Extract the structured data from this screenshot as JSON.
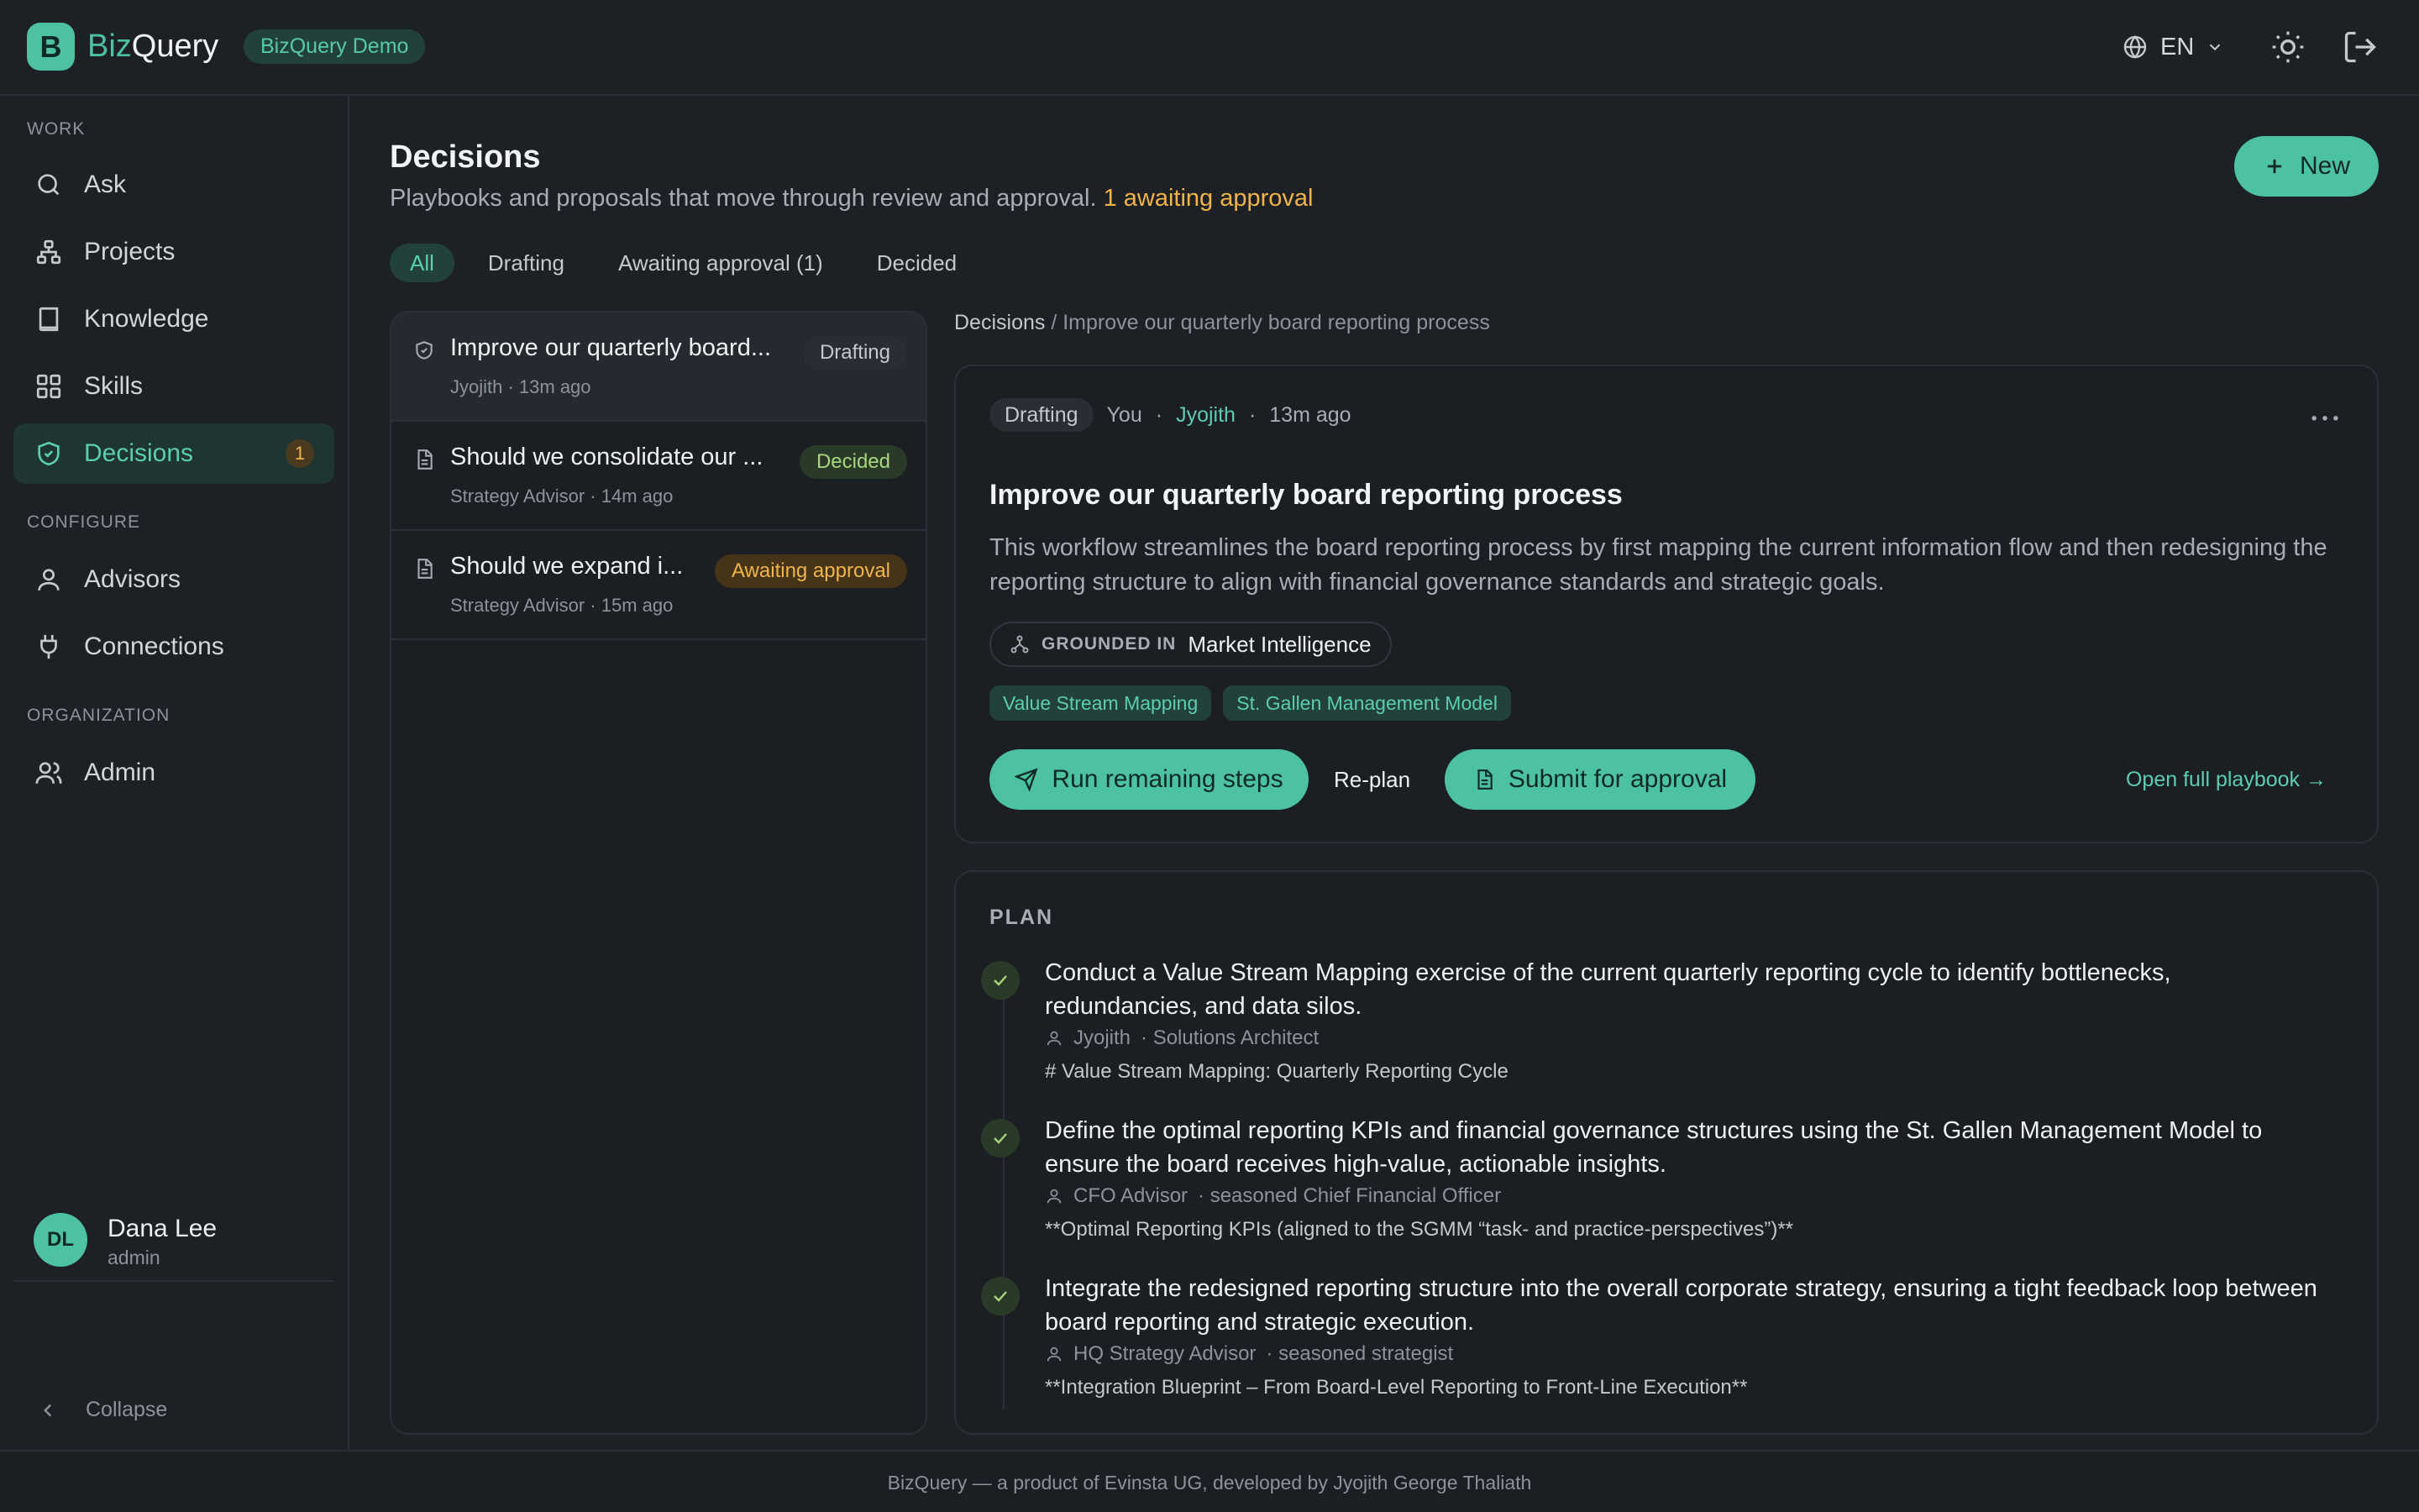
{
  "header": {
    "logo_letter": "B",
    "brand_prefix": "Biz",
    "brand_suffix": "Query",
    "demo_badge": "BizQuery Demo",
    "language": "EN"
  },
  "sidebar": {
    "sections": {
      "work": "WORK",
      "configure": "CONFIGURE",
      "organization": "ORGANIZATION"
    },
    "items": [
      {
        "label": "Ask",
        "icon": "search-icon"
      },
      {
        "label": "Projects",
        "icon": "hierarchy-icon"
      },
      {
        "label": "Knowledge",
        "icon": "book-icon"
      },
      {
        "label": "Skills",
        "icon": "grid-icon"
      },
      {
        "label": "Decisions",
        "icon": "shield-check-icon",
        "active": true,
        "count": "1"
      },
      {
        "label": "Advisors",
        "icon": "user-icon"
      },
      {
        "label": "Connections",
        "icon": "plug-icon"
      },
      {
        "label": "Admin",
        "icon": "users-icon"
      }
    ],
    "user": {
      "initials": "DL",
      "name": "Dana Lee",
      "role": "admin"
    },
    "collapse_label": "Collapse"
  },
  "page": {
    "title": "Decisions",
    "subtitle": "Playbooks and proposals that move through review and approval.",
    "awaiting_text": "1 awaiting approval",
    "new_button": "New",
    "tabs": [
      {
        "label": "All",
        "active": true
      },
      {
        "label": "Drafting"
      },
      {
        "label": "Awaiting approval (1)"
      },
      {
        "label": "Decided"
      }
    ]
  },
  "list": [
    {
      "title": "Improve our quarterly board...",
      "meta": "Jyojith · 13m ago",
      "status": "Drafting",
      "icon": "shield-icon"
    },
    {
      "title": "Should we consolidate our ...",
      "meta": "Strategy Advisor · 14m ago",
      "status": "Decided",
      "icon": "document-icon"
    },
    {
      "title": "Should we expand i...",
      "meta": "Strategy Advisor · 15m ago",
      "status": "Awaiting approval",
      "icon": "document-icon"
    }
  ],
  "detail": {
    "breadcrumb_root": "Decisions",
    "breadcrumb_sep": "/",
    "breadcrumb_current": "Improve our quarterly board reporting process",
    "status": "Drafting",
    "you": "You",
    "dot": "·",
    "author": "Jyojith",
    "time": "13m ago",
    "title": "Improve our quarterly board reporting process",
    "description": "This workflow streamlines the board reporting process by first mapping the current information flow and then redesigning the reporting structure to align with financial governance standards and strategic goals.",
    "grounded_label": "GROUNDED IN",
    "grounded_value": "Market Intelligence",
    "tags": [
      "Value Stream Mapping",
      "St. Gallen Management Model"
    ],
    "run_button": "Run remaining steps",
    "replan_button": "Re-plan",
    "submit_button": "Submit for approval",
    "open_link": "Open full playbook →"
  },
  "plan": {
    "label": "PLAN",
    "steps": [
      {
        "text": "Conduct a Value Stream Mapping exercise of the current quarterly reporting cycle to identify bottlenecks, redundancies, and data silos.",
        "owner": "Jyojith",
        "role": "· Solutions Architect",
        "note": "# Value Stream Mapping: Quarterly Reporting Cycle"
      },
      {
        "text": "Define the optimal reporting KPIs and financial governance structures using the St. Gallen Management Model to ensure the board receives high-value, actionable insights.",
        "owner": "CFO Advisor",
        "role": "· seasoned Chief Financial Officer",
        "note": "**Optimal Reporting KPIs (aligned to the SGMM “task- and practice-perspectives”)**"
      },
      {
        "text": "Integrate the redesigned reporting structure into the overall corporate strategy, ensuring a tight feedback loop between board reporting and strategic execution.",
        "owner": "HQ Strategy Advisor",
        "role": "· seasoned strategist",
        "note": "**Integration Blueprint – From Board-Level Reporting to Front-Line Execution**"
      }
    ]
  },
  "footer": "BizQuery — a product of Evinsta UG, developed by Jyojith George Thaliath",
  "colors": {
    "accent": "#4cc2a3",
    "background": "#1d2024",
    "awaiting": "#f0b44a",
    "decided": "#a7d67d"
  }
}
